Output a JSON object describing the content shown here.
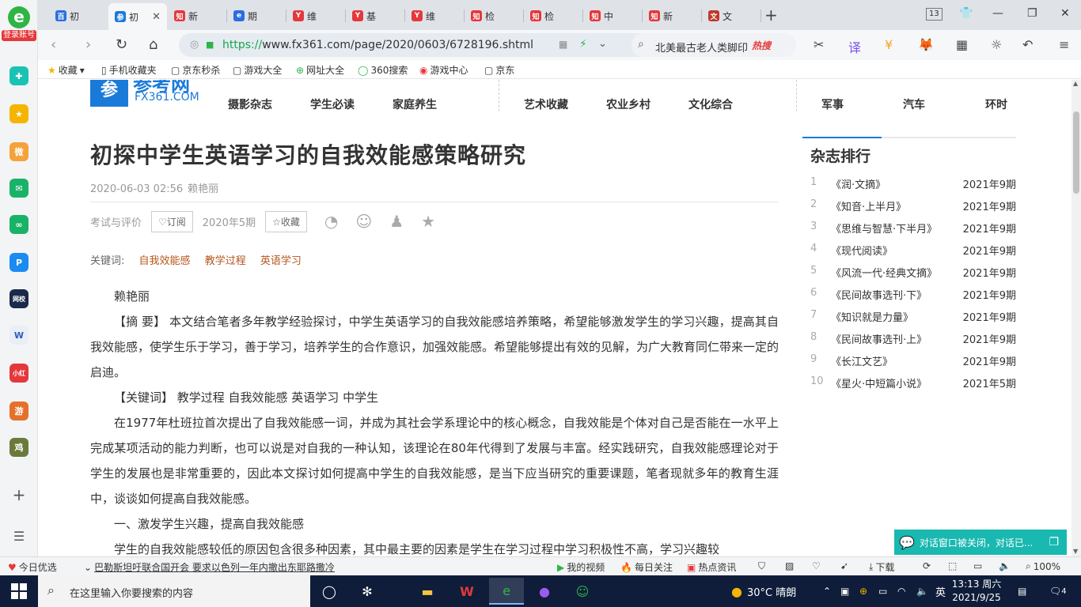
{
  "sidebar": {
    "login_label": "登录账号",
    "apps": [
      "手机助手",
      "收藏",
      "微博",
      "邮箱",
      "360",
      "P",
      "拼团网校",
      "文档",
      "小红书",
      "游戏",
      "吃鸡"
    ],
    "add_label": "+",
    "menu_label": "☰"
  },
  "tabs": [
    {
      "title": "初",
      "icon_color": "#2b6ee0",
      "icon_text": "百"
    },
    {
      "title": "初",
      "icon_color": "#1a7ad9",
      "icon_text": "参",
      "active": true
    },
    {
      "title": "新",
      "icon_color": "#e5383b",
      "icon_text": "知"
    },
    {
      "title": "期",
      "icon_color": "#2b6ee0",
      "icon_text": "e"
    },
    {
      "title": "维",
      "icon_color": "#e5383b",
      "icon_text": "Y"
    },
    {
      "title": "基",
      "icon_color": "#e5383b",
      "icon_text": "Y"
    },
    {
      "title": "维",
      "icon_color": "#e5383b",
      "icon_text": "Y"
    },
    {
      "title": "检",
      "icon_color": "#e5383b",
      "icon_text": "知"
    },
    {
      "title": "检",
      "icon_color": "#e5383b",
      "icon_text": "知"
    },
    {
      "title": "中",
      "icon_color": "#e5383b",
      "icon_text": "知"
    },
    {
      "title": "新",
      "icon_color": "#e5383b",
      "icon_text": "知"
    },
    {
      "title": "文",
      "icon_color": "#c0392b",
      "icon_text": "文"
    }
  ],
  "tab_count": "13",
  "address": {
    "url_prefix": "https://",
    "url_host": "www.fx361.com",
    "url_path": "/page/2020/0603/6728196.shtml",
    "search_text": "北美最古老人类脚印",
    "hot_label": "热搜"
  },
  "bookmarks": [
    "收藏",
    "手机收藏夹",
    "京东秒杀",
    "游戏大全",
    "网址大全",
    "360搜索",
    "游戏中心",
    "京东"
  ],
  "site": {
    "logo_cn": "参考网",
    "logo_en": "FX361.COM",
    "nav_top": [
      "摄影杂志",
      "学生必读",
      "家庭养生",
      "艺术收藏",
      "农业乡村",
      "文化综合",
      "军事",
      "汽车",
      "环时"
    ]
  },
  "article": {
    "title": "初探中学生英语学习的自我效能感策略研究",
    "date": "2020-06-03 02:56",
    "author": "赖艳丽",
    "category": "考试与评价",
    "subscribe": "♡订阅",
    "issue": "2020年5期",
    "favorite": "☆收藏",
    "keywords_label": "关键词:",
    "keywords": [
      "自我效能感",
      "教学过程",
      "英语学习"
    ],
    "paragraphs": [
      "赖艳丽",
      "【摘 要】 本文结合笔者多年教学经验探讨，中学生英语学习的自我效能感培养策略，希望能够激发学生的学习兴趣，提高其自我效能感，使学生乐于学习，善于学习，培养学生的合作意识，加强效能感。希望能够提出有效的见解，为广大教育同仁带来一定的启迪。",
      "【关键词】 教学过程  自我效能感  英语学习  中学生",
      "在1977年杜班拉首次提出了自我效能感一词，并成为其社会学系理论中的核心概念，自我效能是个体对自己是否能在一水平上完成某项活动的能力判断，也可以说是对自我的一种认知，该理论在80年代得到了发展与丰富。经实践研究，自我效能感理论对于学生的发展也是非常重要的，因此本文探讨如何提高中学生的自我效能感，是当下应当研究的重要课题，笔者现就多年的教育生涯中，谈谈如何提高自我效能感。",
      "一、激发学生兴趣，提高自我效能感",
      "学生的自我效能感较低的原因包含很多种因素，其中最主要的因素是学生在学习过程中学习积极性不高，学习兴趣较"
    ]
  },
  "ranking": {
    "title": "杂志排行",
    "items": [
      {
        "num": "1",
        "name": "《润·文摘》",
        "date": "2021年9期"
      },
      {
        "num": "2",
        "name": "《知音·上半月》",
        "date": "2021年9期"
      },
      {
        "num": "3",
        "name": "《思维与智慧·下半月》",
        "date": "2021年9期"
      },
      {
        "num": "4",
        "name": "《现代阅读》",
        "date": "2021年9期"
      },
      {
        "num": "5",
        "name": "《风流一代·经典文摘》",
        "date": "2021年9期"
      },
      {
        "num": "6",
        "name": "《民间故事选刊·下》",
        "date": "2021年9期"
      },
      {
        "num": "7",
        "name": "《知识就是力量》",
        "date": "2021年9期"
      },
      {
        "num": "8",
        "name": "《民间故事选刊·上》",
        "date": "2021年9期"
      },
      {
        "num": "9",
        "name": "《长江文艺》",
        "date": "2021年9期"
      },
      {
        "num": "10",
        "name": "《星火·中短篇小说》",
        "date": "2021年5期"
      }
    ]
  },
  "chat_popup": "对话窗口被关闭，对话已...",
  "statusbar": {
    "today": "今日优选",
    "news": "巴勒斯坦吁联合国开会 要求以色列一年内撤出东耶路撒冷",
    "video": "我的视频",
    "daily": "每日关注",
    "hot": "热点资讯",
    "download": "下载",
    "zoom": "100%"
  },
  "taskbar": {
    "search_placeholder": "在这里输入你要搜索的内容",
    "weather": "30°C 晴朗",
    "ime": "英",
    "time": "13:13 周六",
    "date": "2021/9/25",
    "notif": "4"
  }
}
